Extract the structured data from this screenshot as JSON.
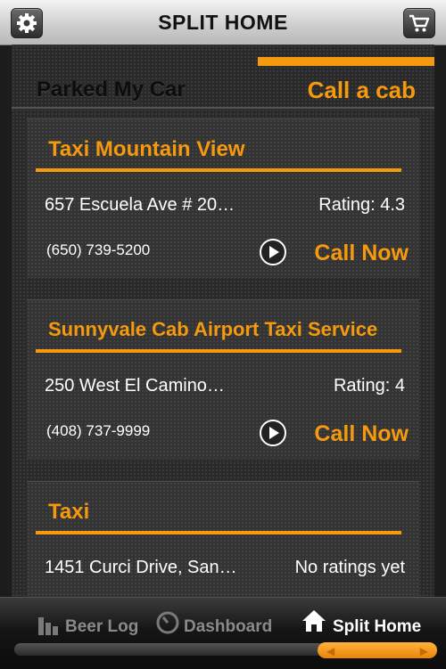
{
  "header": {
    "title": "SPLIT HOME"
  },
  "tabs": {
    "parked": "Parked My Car",
    "cab": "Call a cab"
  },
  "cabs": [
    {
      "name": "Taxi Mountain View",
      "address": "657 Escuela Ave # 20…",
      "rating": "Rating: 4.3",
      "phone": "(650) 739-5200",
      "call": "Call Now"
    },
    {
      "name": "Sunnyvale Cab Airport Taxi Service",
      "address": "250 West El Camino…",
      "rating": "Rating: 4",
      "phone": "(408) 737-9999",
      "call": "Call Now"
    },
    {
      "name": "Taxi",
      "address": "1451 Curci Drive, San…",
      "rating": "No ratings yet"
    }
  ],
  "tabbar": {
    "beer": "Beer Log",
    "dashboard": "Dashboard",
    "split": "Split Home"
  },
  "colors": {
    "accent": "#f59a0e"
  }
}
